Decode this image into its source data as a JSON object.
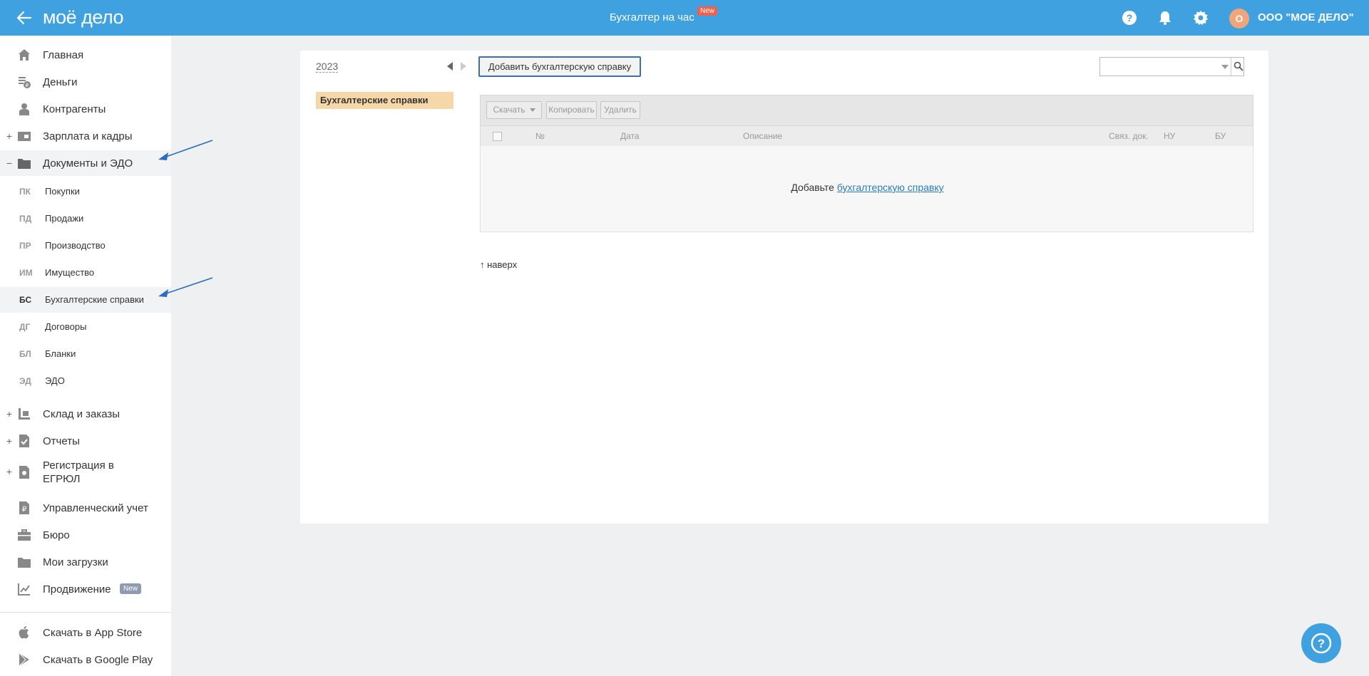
{
  "header": {
    "logo": "моё дело",
    "center_title": "Бухгалтер на час",
    "center_badge": "New",
    "avatar_letter": "О",
    "company_name": "ООО \"МОЕ ДЕЛО\"",
    "brand_color": "#3fa1e0"
  },
  "sidebar": {
    "items": [
      {
        "label": "Главная",
        "icon": "home-icon"
      },
      {
        "label": "Деньги",
        "icon": "money-icon"
      },
      {
        "label": "Контрагенты",
        "icon": "contractors-icon"
      },
      {
        "label": "Зарплата и кадры",
        "icon": "salary-icon",
        "expand": "+"
      },
      {
        "label": "Документы и ЭДО",
        "icon": "folder-icon",
        "expand": "−"
      }
    ],
    "sub_items": [
      {
        "abbr": "ПК",
        "label": "Покупки"
      },
      {
        "abbr": "ПД",
        "label": "Продажи"
      },
      {
        "abbr": "ПР",
        "label": "Производство"
      },
      {
        "abbr": "ИМ",
        "label": "Имущество"
      },
      {
        "abbr": "БС",
        "label": "Бухгалтерские справки"
      },
      {
        "abbr": "ДГ",
        "label": "Договоры"
      },
      {
        "abbr": "БЛ",
        "label": "Бланки"
      },
      {
        "abbr": "ЭД",
        "label": "ЭДО"
      }
    ],
    "items2": [
      {
        "label": "Склад и заказы",
        "icon": "warehouse-icon",
        "expand": "+"
      },
      {
        "label": "Отчеты",
        "icon": "reports-icon",
        "expand": "+"
      },
      {
        "label": "Регистрация в",
        "label2": "ЕГРЮЛ",
        "icon": "registration-icon",
        "expand": "+"
      },
      {
        "label": "Управленческий учет",
        "icon": "management-icon"
      },
      {
        "label": "Бюро",
        "icon": "briefcase-icon"
      },
      {
        "label": "Мои загрузки",
        "icon": "downloads-folder-icon"
      },
      {
        "label": "Продвижение",
        "icon": "promotion-icon",
        "badge": "New"
      }
    ],
    "apps": [
      {
        "label": "Скачать в App Store",
        "icon": "apple-icon"
      },
      {
        "label": "Скачать в Google Play",
        "icon": "google-play-icon"
      }
    ]
  },
  "main": {
    "year": "2023",
    "left_tab": "Бухгалтерские справки",
    "add_button": "Добавить бухгалтерскую справку",
    "toolbar": {
      "download": "Скачать",
      "copy": "Копировать",
      "delete": "Удалить"
    },
    "columns": {
      "number": "№",
      "date": "Дата",
      "description": "Описание",
      "linked_docs": "Связ. док.",
      "nu": "НУ",
      "bu": "БУ"
    },
    "empty_prefix": "Добавьте ",
    "empty_link": "бухгалтерскую справку",
    "to_top": "↑ наверх"
  }
}
